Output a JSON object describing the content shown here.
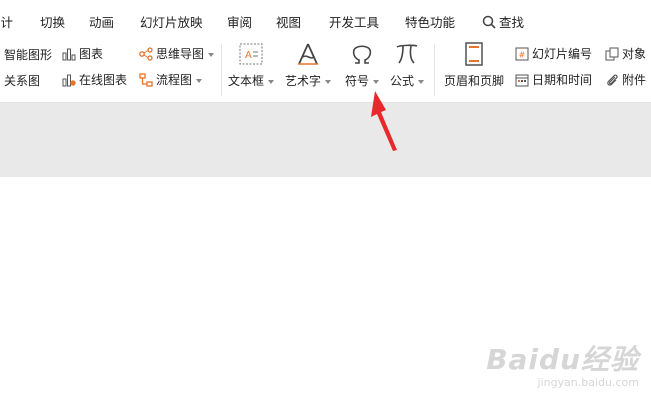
{
  "menubar": {
    "items": [
      "设计",
      "切换",
      "动画",
      "幻灯片放映",
      "审阅",
      "视图",
      "开发工具",
      "特色功能"
    ],
    "search_label": "查找"
  },
  "ribbon": {
    "smart_art": "智能图形",
    "chart": "图表",
    "relation": "关系图",
    "online_chart": "在线图表",
    "mindmap": "思维导图",
    "flowchart": "流程图",
    "textbox": "文本框",
    "wordart": "艺术字",
    "symbol": "符号",
    "formula": "公式",
    "header_footer": "页眉和页脚",
    "slide_number": "幻灯片编号",
    "datetime": "日期和时间",
    "object": "对象",
    "attachment": "附件"
  },
  "annotation": {
    "arrow_color": "#e8282b"
  },
  "watermark": {
    "brand": "Baidu经验",
    "url": "jingyan.baidu.com"
  }
}
